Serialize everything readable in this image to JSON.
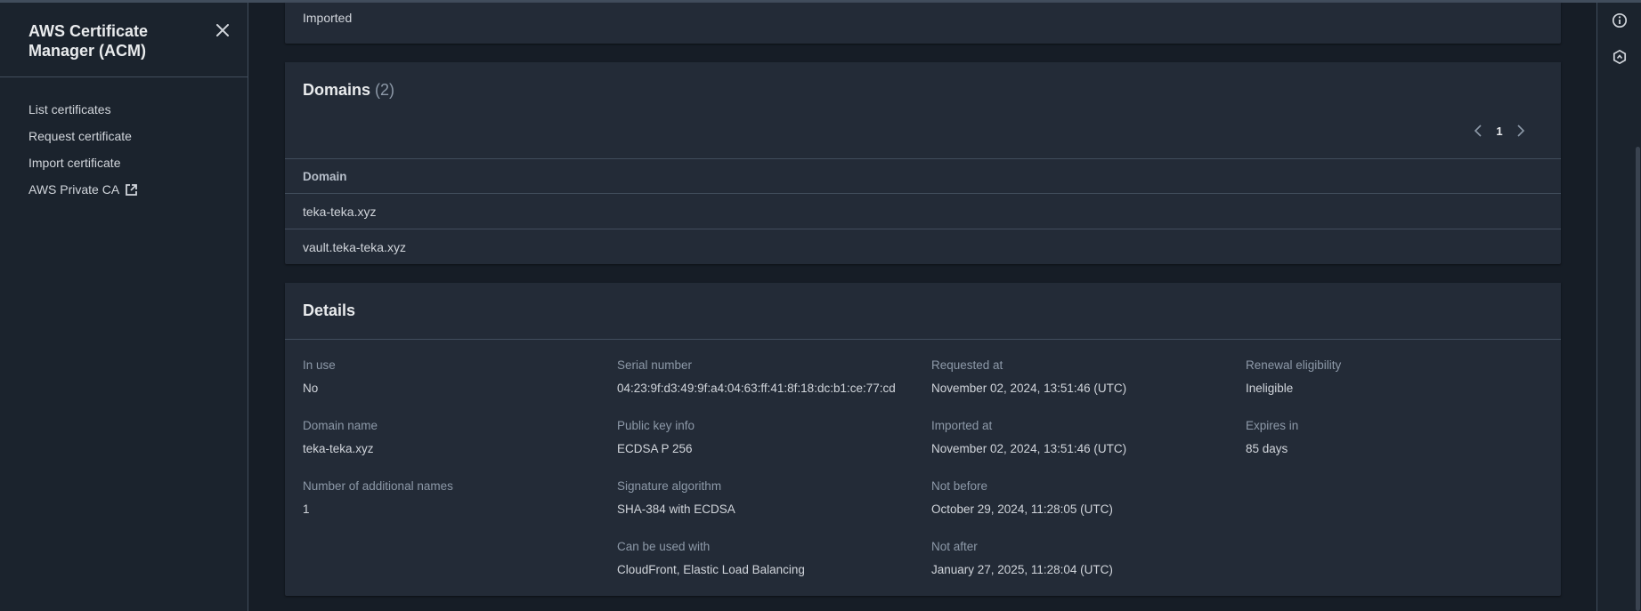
{
  "sidebar": {
    "title": "AWS Certificate Manager (ACM)",
    "close_icon": "close-icon",
    "items": [
      {
        "label": "List certificates"
      },
      {
        "label": "Request certificate"
      },
      {
        "label": "Import certificate"
      },
      {
        "label": "AWS Private CA",
        "icon": "external-link-icon"
      }
    ]
  },
  "top_card": {
    "text": "Imported"
  },
  "domains": {
    "title": "Domains",
    "count": "(2)",
    "pagination": {
      "current_page": "1"
    },
    "column_header": "Domain",
    "rows": [
      "teka-teka.xyz",
      "vault.teka-teka.xyz"
    ]
  },
  "details": {
    "title": "Details",
    "fields": {
      "in_use": {
        "label": "In use",
        "value": "No"
      },
      "domain_name": {
        "label": "Domain name",
        "value": "teka-teka.xyz"
      },
      "additional_names": {
        "label": "Number of additional names",
        "value": "1"
      },
      "serial_number": {
        "label": "Serial number",
        "value": "04:23:9f:d3:49:9f:a4:04:63:ff:41:8f:18:dc:b1:ce:77:cd"
      },
      "public_key_info": {
        "label": "Public key info",
        "value": "ECDSA P 256"
      },
      "signature_algorithm": {
        "label": "Signature algorithm",
        "value": "SHA-384 with ECDSA"
      },
      "can_be_used_with": {
        "label": "Can be used with",
        "value": "CloudFront, Elastic Load Balancing"
      },
      "requested_at": {
        "label": "Requested at",
        "value": "November 02, 2024, 13:51:46 (UTC)"
      },
      "imported_at": {
        "label": "Imported at",
        "value": "November 02, 2024, 13:51:46 (UTC)"
      },
      "not_before": {
        "label": "Not before",
        "value": "October 29, 2024, 11:28:05 (UTC)"
      },
      "not_after": {
        "label": "Not after",
        "value": "January 27, 2025, 11:28:04 (UTC)"
      },
      "renewal_eligibility": {
        "label": "Renewal eligibility",
        "value": "Ineligible"
      },
      "expires_in": {
        "label": "Expires in",
        "value": "85 days"
      }
    }
  },
  "right_rail": {
    "icons": [
      "info-icon",
      "settings-hex-icon"
    ]
  },
  "colors": {
    "background": "#161d26",
    "card": "#232b37",
    "border": "#414d5c",
    "text": "#d1d5db",
    "muted": "#8d99a8"
  }
}
